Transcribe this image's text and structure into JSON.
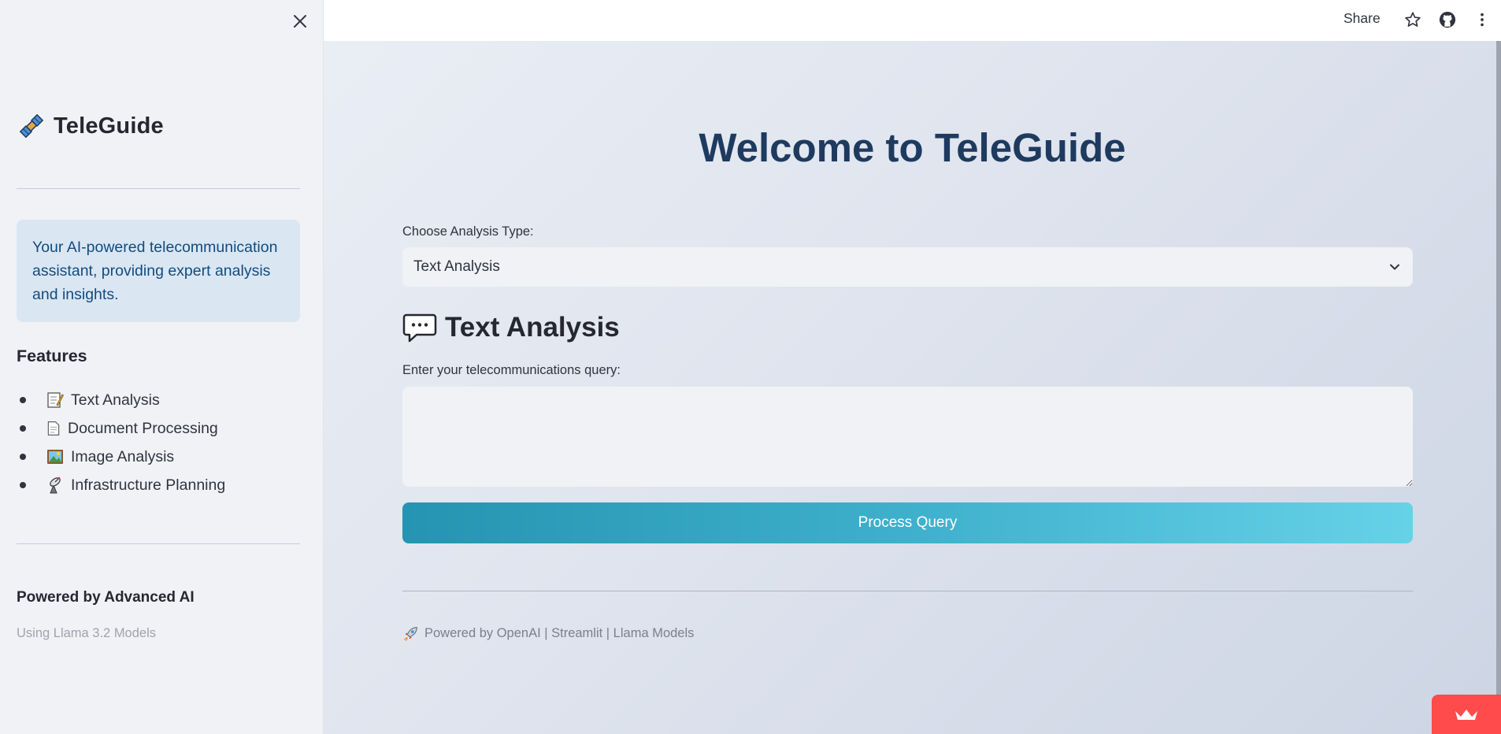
{
  "sidebar": {
    "brand_title": "TeleGuide",
    "brand_icon": "satellite-icon",
    "info_text": "Your AI-powered telecommunication assistant, providing expert analysis and insights.",
    "features_title": "Features",
    "features": [
      {
        "icon": "memo-icon",
        "label": "Text Analysis"
      },
      {
        "icon": "page-icon",
        "label": "Document Processing"
      },
      {
        "icon": "picture-icon",
        "label": "Image Analysis"
      },
      {
        "icon": "antenna-icon",
        "label": "Infrastructure Planning"
      }
    ],
    "powered_title": "Powered by Advanced AI",
    "powered_sub": "Using Llama 3.2 Models"
  },
  "topbar": {
    "share_label": "Share",
    "icons": [
      "star-icon",
      "github-icon",
      "more-vertical-icon"
    ]
  },
  "main": {
    "welcome": "Welcome to TeleGuide",
    "select_label": "Choose Analysis Type:",
    "select_value": "Text Analysis",
    "section_title": "Text Analysis",
    "section_icon": "speech-bubble-icon",
    "query_label": "Enter your telecommunications query:",
    "query_value": "",
    "process_button": "Process Query",
    "footer_text": "Powered by OpenAI | Streamlit | Llama Models",
    "footer_icon": "rocket-icon"
  },
  "colors": {
    "sidebar_bg": "#f0f2f6",
    "info_bg": "#dbe6f3",
    "info_text": "#0f4c81",
    "heading": "#1e3a5f",
    "button_start": "#2594b2",
    "button_end": "#66d2e8",
    "badge": "#ff4b4b"
  }
}
